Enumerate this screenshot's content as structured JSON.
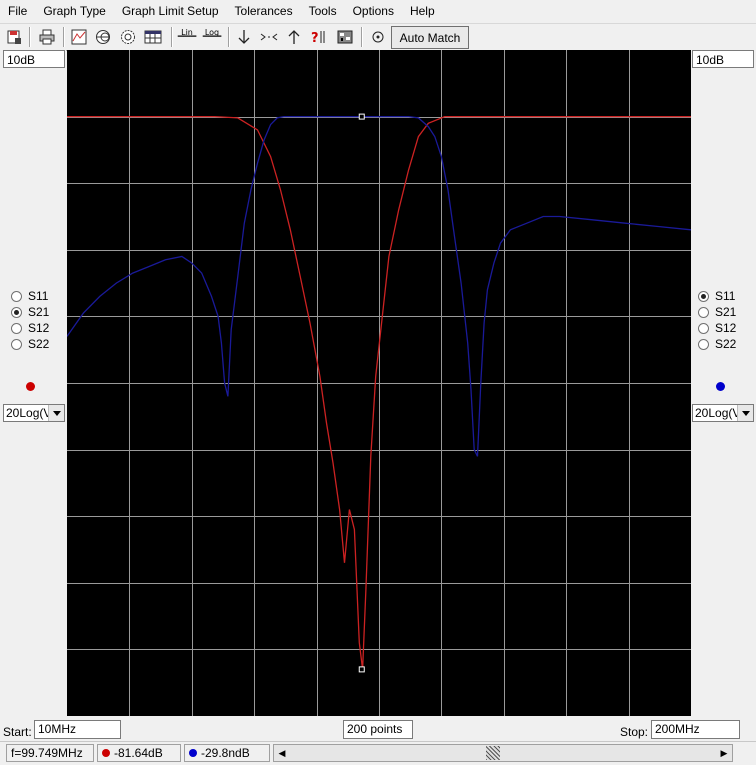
{
  "menu": [
    "File",
    "Graph Type",
    "Graph Limit Setup",
    "Tolerances",
    "Tools",
    "Options",
    "Help"
  ],
  "toolbar": {
    "lin_label": "Lin",
    "log_label": "Log",
    "auto_match_label": "Auto Match",
    "icons": [
      "save-report-icon",
      "print-icon",
      "rect-graph-icon",
      "smith-chart-icon",
      "polar-chart-icon",
      "table-icon",
      "lin-scale-icon",
      "log-scale-icon",
      "arrow-down-icon",
      "compress-icon",
      "arrow-up-icon",
      "help-icon",
      "component-icon",
      "reset-icon"
    ]
  },
  "left_panel": {
    "scale": "10dB",
    "params": [
      "S11",
      "S21",
      "S12",
      "S22"
    ],
    "selected": "S21",
    "trace_color": "#cc0000",
    "format": "20Log(V"
  },
  "right_panel": {
    "scale": "10dB",
    "params": [
      "S11",
      "S21",
      "S12",
      "S22"
    ],
    "selected": "S11",
    "trace_color": "#0000cc",
    "format": "20Log(V"
  },
  "sweep": {
    "start_label": "Start:",
    "start_value": "10MHz",
    "points": "200 points",
    "stop_label": "Stop:",
    "stop_value": "200MHz"
  },
  "status": {
    "frequency": "f=99.749MHz",
    "marker1_value": "-81.64dB",
    "marker2_value": "-29.8ndB"
  },
  "chart_data": {
    "type": "line",
    "x_range_mhz": [
      10,
      200
    ],
    "grid": true,
    "grid_divisions_x": 10,
    "grid_divisions_y": 10,
    "y_scale_per_div_db": 10,
    "series": [
      {
        "name": "S21",
        "color": "#cc2222",
        "x": [
          10,
          40,
          55,
          62,
          68,
          72,
          75,
          78,
          81,
          84,
          87,
          89,
          91,
          93,
          94.5,
          96,
          97.5,
          99,
          100,
          101,
          102.5,
          104,
          106,
          108,
          111,
          114,
          117,
          120,
          125,
          130,
          140,
          160,
          200
        ],
        "y_div": [
          1,
          1,
          1,
          1.02,
          1.2,
          1.6,
          2.1,
          2.7,
          3.4,
          4.1,
          4.9,
          5.6,
          6.2,
          6.9,
          7.7,
          6.9,
          7.2,
          8.9,
          9.3,
          8.1,
          6.1,
          4.9,
          4.0,
          3.1,
          2.4,
          1.8,
          1.3,
          1.1,
          1.0,
          1.0,
          1.0,
          1.0,
          1.0
        ]
      },
      {
        "name": "S11",
        "color": "#1a1a99",
        "x": [
          10,
          15,
          20,
          25,
          30,
          35,
          40,
          45,
          48,
          51,
          54,
          56,
          57,
          58,
          59,
          60,
          62,
          64,
          66,
          68,
          70,
          72,
          74,
          76,
          78,
          80,
          85,
          90,
          95,
          100,
          105,
          110,
          114,
          117,
          120,
          122,
          124,
          126,
          128,
          130,
          132,
          133,
          134,
          135,
          136,
          137,
          138,
          140,
          142,
          145,
          150,
          155,
          160,
          170,
          180,
          190,
          200
        ],
        "y_div": [
          4.3,
          3.95,
          3.7,
          3.5,
          3.35,
          3.25,
          3.15,
          3.1,
          3.2,
          3.35,
          3.7,
          4.0,
          4.4,
          5.0,
          5.2,
          4.2,
          3.4,
          2.6,
          2.1,
          1.7,
          1.35,
          1.12,
          1.02,
          1.0,
          1.0,
          1.0,
          1.0,
          1.0,
          1.0,
          1.0,
          1.0,
          1.0,
          1.0,
          1.02,
          1.15,
          1.3,
          1.6,
          2.1,
          2.8,
          3.5,
          4.4,
          5.1,
          6.0,
          6.1,
          5.0,
          4.1,
          3.6,
          3.2,
          2.9,
          2.7,
          2.6,
          2.5,
          2.5,
          2.55,
          2.6,
          2.65,
          2.7
        ]
      }
    ],
    "markers": [
      {
        "series": "S21",
        "x": 99.749,
        "y_div": 9.3
      },
      {
        "series": "S11",
        "x": 99.749,
        "y_div": 1.0
      }
    ]
  }
}
